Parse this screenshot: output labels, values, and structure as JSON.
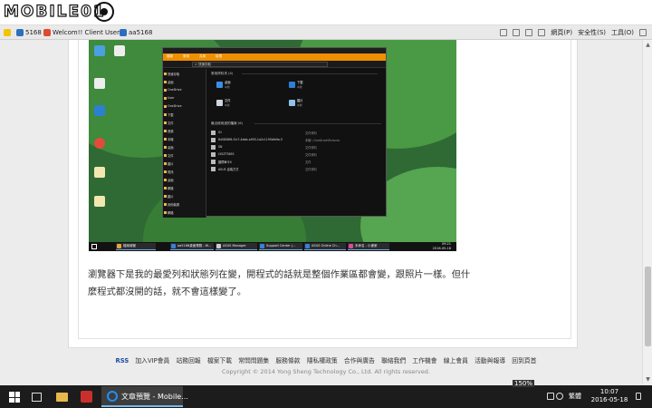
{
  "site": {
    "logo_text": "MOBILE01"
  },
  "favorites": [
    {
      "label": "5168",
      "color": "#2c6fbf"
    },
    {
      "label": "Welcom!! Client User!!",
      "color": "#e04a2e"
    },
    {
      "label": "aa5168",
      "color": "#2c6fbf"
    }
  ],
  "cmdbar": {
    "web": "網頁(P)",
    "security": "安全性(S)",
    "tools": "工具(O)"
  },
  "screenshot": {
    "explorer_tabs": [
      "檔案",
      "常用",
      "共用",
      "檢視"
    ],
    "address": "> 快速存取",
    "sidebar": [
      "快速存取",
      "桌面",
      "OneDrive",
      "User",
      "OneDrive",
      "下載",
      "文件",
      "音樂",
      "本機",
      "桌面",
      "文件",
      "圖片",
      "視訊",
      "桌面",
      "網路",
      "圖片",
      "其他裝置",
      "網路"
    ],
    "section_frequent": "常用資料夾 (4)",
    "frequent": [
      {
        "name": "桌面",
        "sub": "本機"
      },
      {
        "name": "下載",
        "sub": "本機"
      },
      {
        "name": "文件",
        "sub": "本機"
      },
      {
        "name": "圖片",
        "sub": "本機"
      }
    ],
    "section_recent": "最近使用過的檔案 (6)",
    "recent": [
      {
        "name": "01",
        "path": "文件資料"
      },
      {
        "name": "840858f6-f2c7-4ebb-a955-1a2c1195bfe9a.5",
        "path": "本機 \\ OneDrive\\Pictures"
      },
      {
        "name": "SN",
        "path": "文件資料"
      },
      {
        "name": "LYSZT365S",
        "path": "文件資料"
      },
      {
        "name": "圖標單卡0",
        "path": "文件"
      },
      {
        "name": "ASUS 遠端方式",
        "path": "文件資料"
      }
    ],
    "taskbar_items": [
      "檔案總管",
      "aa5168桌面預覽 - W...",
      "ASUS Manager",
      "Support Center (...",
      "ASUS Online Ch...",
      "未命名 - 小畫家"
    ],
    "time": "09:21",
    "date": "2016-05-18"
  },
  "article_text": "瀏覽器下是我的最愛列和狀態列在變，開程式的話就是整個作業區都會變，跟照片一樣。但什麼程式都沒開的話，就不會這樣變了。",
  "footer_links": [
    "RSS",
    "加入VIP會員",
    "站務回報",
    "檔案下載",
    "常問問題集",
    "服務條款",
    "隱私權政策",
    "合作與廣告",
    "聯絡我們",
    "工作機會",
    "線上會員",
    "活動與報導",
    "回到頁首"
  ],
  "copyright": "Copyright © 2014 Yong Sheng Technology Co., Ltd. All rights reserved.",
  "taskbar": {
    "active_window": "文章預覽 - Mobile...",
    "zoom": "150%",
    "ime": "繁體",
    "time": "10:07",
    "date": "2016-05-18"
  }
}
